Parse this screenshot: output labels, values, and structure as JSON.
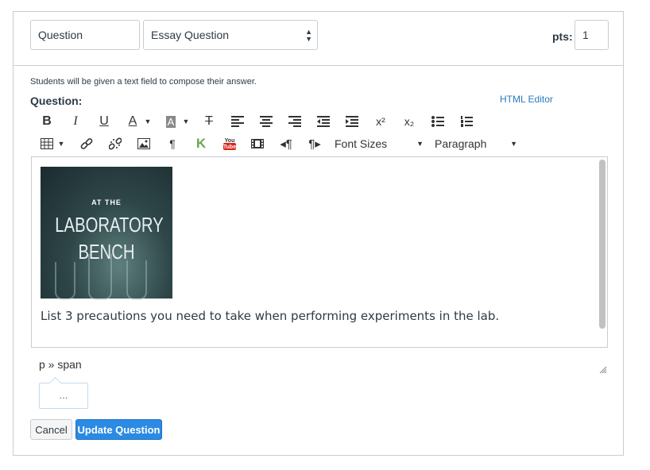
{
  "question_name": "Question",
  "question_type": "Essay Question",
  "pts_label": "pts:",
  "pts_value": "1",
  "hint": "Students will be given a text field to compose their answer.",
  "question_label": "Question:",
  "html_editor_link": "HTML Editor",
  "toolbar": {
    "bold": "B",
    "italic": "I",
    "underline": "U",
    "font_color": "A",
    "bg_color": "A",
    "clear": "T",
    "superscript": "x²",
    "subscript": "x₂",
    "font_sizes": "Font Sizes",
    "format": "Paragraph",
    "icons": [
      "bold-icon",
      "italic-icon",
      "underline-icon",
      "text-color-icon",
      "background-color-icon",
      "clear-formatting-icon",
      "align-left-icon",
      "align-center-icon",
      "align-right-icon",
      "outdent-icon",
      "indent-icon",
      "superscript-icon",
      "subscript-icon",
      "bullet-list-icon",
      "numbered-list-icon",
      "table-icon",
      "link-icon",
      "unlink-icon",
      "image-icon",
      "paragraph-icon",
      "kaltura-icon",
      "youtube-icon",
      "media-icon",
      "ltr-icon",
      "rtl-icon"
    ]
  },
  "image": {
    "line1": "AT THE",
    "line2": "LABORATORY",
    "line3": "BENCH"
  },
  "editor_text": "List 3 precautions you need to take when performing experiments in the lab.",
  "element_path": "p » span",
  "more_button": "...",
  "cancel_label": "Cancel",
  "update_label": "Update Question",
  "colors": {
    "accent": "#2b8ae3",
    "link": "#2b7abc",
    "border": "#c7cdd1"
  }
}
